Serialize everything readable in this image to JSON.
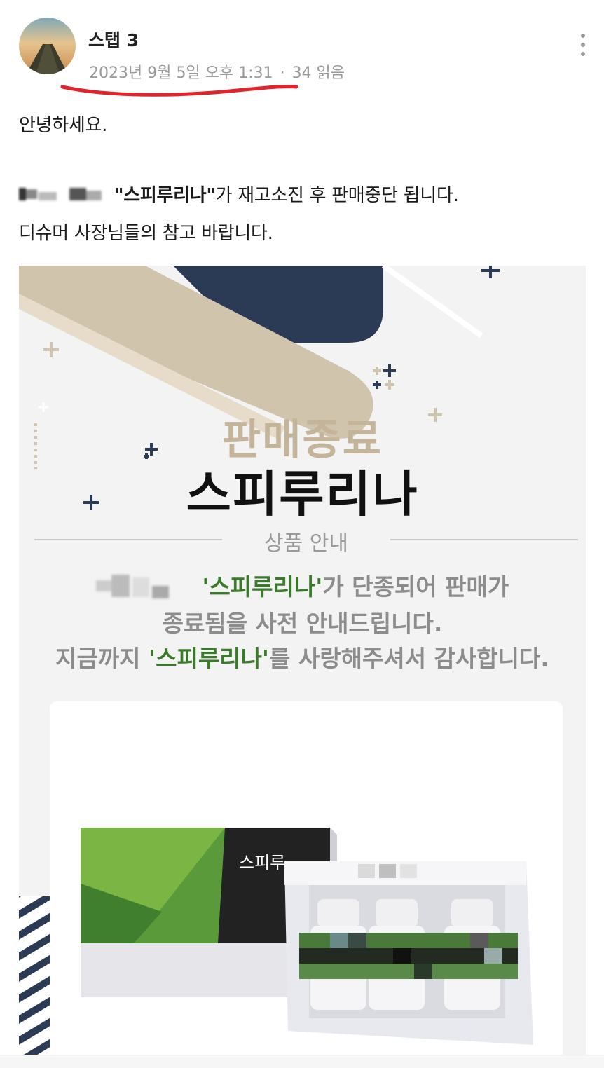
{
  "post": {
    "author": "스탭 3",
    "date": "2023년 9월 5일 오후 1:31",
    "separator": "·",
    "views": "34 읽음"
  },
  "body": {
    "greeting": "안녕하세요.",
    "line1_quote_open": "\"",
    "line1_product": "스피루리나",
    "line1_quote_close": "\"",
    "line1_rest": "가 재고소진 후 판매중단 됩니다.",
    "line2": "디슈머 사장님들의 참고 바랍니다."
  },
  "banner": {
    "headline_top": "판매종료",
    "headline_main": "스피루리나",
    "section_label": "상품 안내",
    "notice_line1_product": "'스피루리나'",
    "notice_line1_rest": "가 단종되어 판매가",
    "notice_line2": "종료됨을 사전 안내드립니다.",
    "notice_line3_prefix": "지금까지 ",
    "notice_line3_product": "'스피루리나'",
    "notice_line3_rest": "를 사랑해주셔서 감사합니다.",
    "box_label": "스피루"
  },
  "colors": {
    "accent_green": "#3a7a2a",
    "navy": "#2b3a55",
    "beige": "#d1c4ad",
    "meta_gray": "#9a9a9a",
    "underline_red": "#e0242b"
  },
  "icons": {
    "more": "more-vertical-icon",
    "avatar": "profile-photo"
  }
}
